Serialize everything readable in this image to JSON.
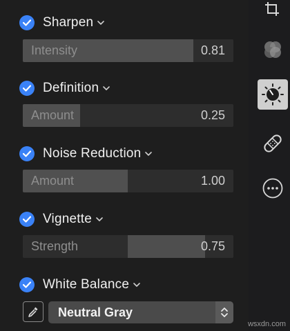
{
  "sections": [
    {
      "title": "Sharpen",
      "checked": true,
      "slider": {
        "label": "Intensity",
        "value": "0.81",
        "fill_fraction": 0.81
      }
    },
    {
      "title": "Definition",
      "checked": true,
      "slider": {
        "label": "Amount",
        "value": "0.25",
        "fill_fraction": 0.25
      }
    },
    {
      "title": "Noise Reduction",
      "checked": true,
      "slider": {
        "label": "Amount",
        "value": "1.00",
        "fill_fraction": 0.5
      }
    },
    {
      "title": "Vignette",
      "checked": true,
      "slider": {
        "label": "Strength",
        "value": "0.75",
        "fill_fraction": 0.5
      }
    },
    {
      "title": "White Balance",
      "checked": true,
      "select": {
        "selected": "Neutral Gray"
      }
    }
  ],
  "sidebar": {
    "items": [
      {
        "name": "crop-icon",
        "active": false
      },
      {
        "name": "filters-icon",
        "active": false
      },
      {
        "name": "adjust-icon",
        "active": true
      },
      {
        "name": "retouch-icon",
        "active": false
      },
      {
        "name": "more-icon",
        "active": false
      }
    ]
  },
  "watermark": "wsxdn.com",
  "colors": {
    "accent": "#3a82f7",
    "background": "#1e1e1e",
    "slider_track": "#2d2d2d",
    "slider_fill": "#505050"
  }
}
